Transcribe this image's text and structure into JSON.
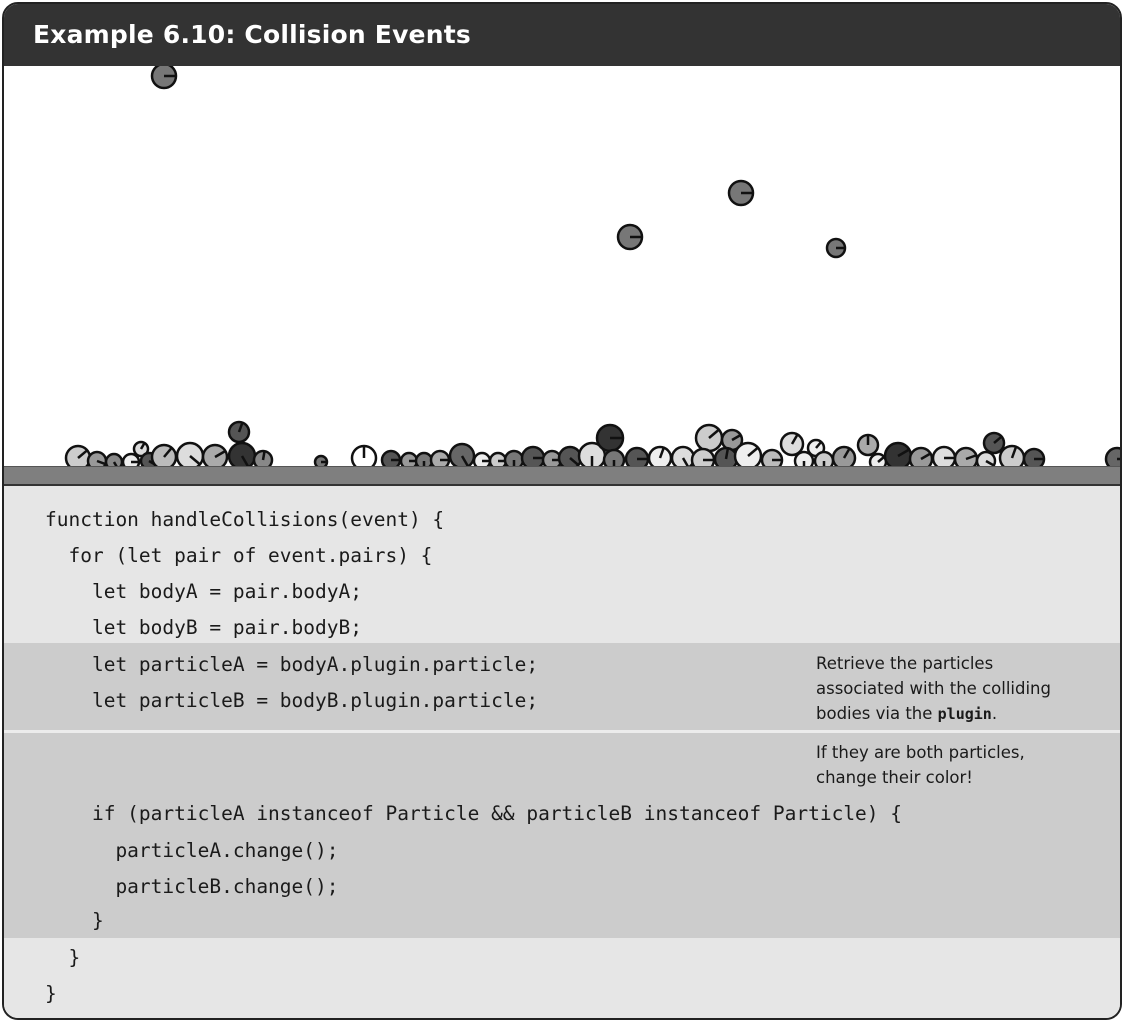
{
  "title": "Example 6.10: Collision Events",
  "colors": {
    "title_bg": "#333333",
    "canvas_bg": "#ffffff",
    "ground": "#7f7f7f",
    "code_bg": "#e6e6e6",
    "highlight_bg": "#cccccc"
  },
  "code": {
    "line1": "function handleCollisions(event) {",
    "line2": "  for (let pair of event.pairs) {",
    "line3": "    let bodyA = pair.bodyA;",
    "line4": "    let bodyB = pair.bodyB;",
    "line5": "    let particleA = bodyA.plugin.particle;",
    "line6": "    let particleB = bodyB.plugin.particle;",
    "line7": "    if (particleA instanceof Particle && particleB instanceof Particle) {",
    "line8": "      particleA.change();",
    "line9": "      particleB.change();",
    "line10": "    }",
    "line11": "  }",
    "line12": "}"
  },
  "notes": {
    "note1_before": "Retrieve the particles associated with the colliding bodies via the ",
    "note1_code": "plugin",
    "note1_after": ".",
    "note2": "If they are both particles, change their color!"
  }
}
